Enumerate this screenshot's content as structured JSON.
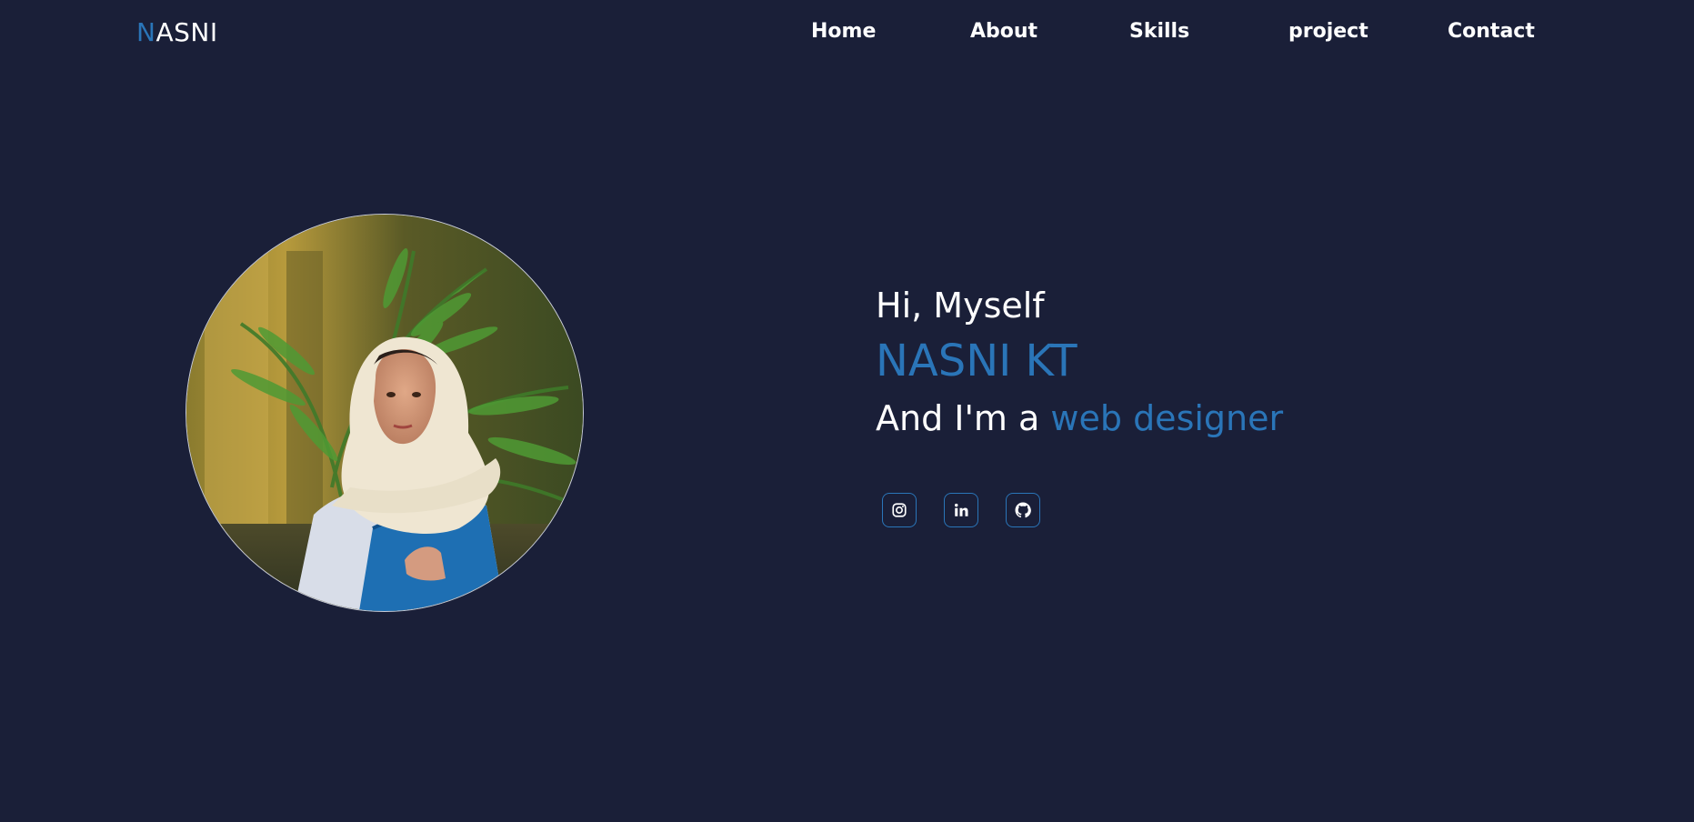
{
  "brand": {
    "logo_first": "N",
    "logo_rest": "ASNI"
  },
  "nav": {
    "items": [
      {
        "label": "Home"
      },
      {
        "label": "About"
      },
      {
        "label": "Skills"
      },
      {
        "label": "project"
      },
      {
        "label": "Contact"
      }
    ]
  },
  "hero": {
    "greeting": "Hi, Myself",
    "name": "NASNI KT",
    "role_prefix": "And I'm a ",
    "role_highlight": "web designer"
  },
  "socials": [
    {
      "icon": "instagram-icon"
    },
    {
      "icon": "linkedin-icon"
    },
    {
      "icon": "github-icon"
    }
  ],
  "colors": {
    "background": "#1a1f38",
    "accent": "#2a75b8",
    "text": "#ffffff"
  }
}
